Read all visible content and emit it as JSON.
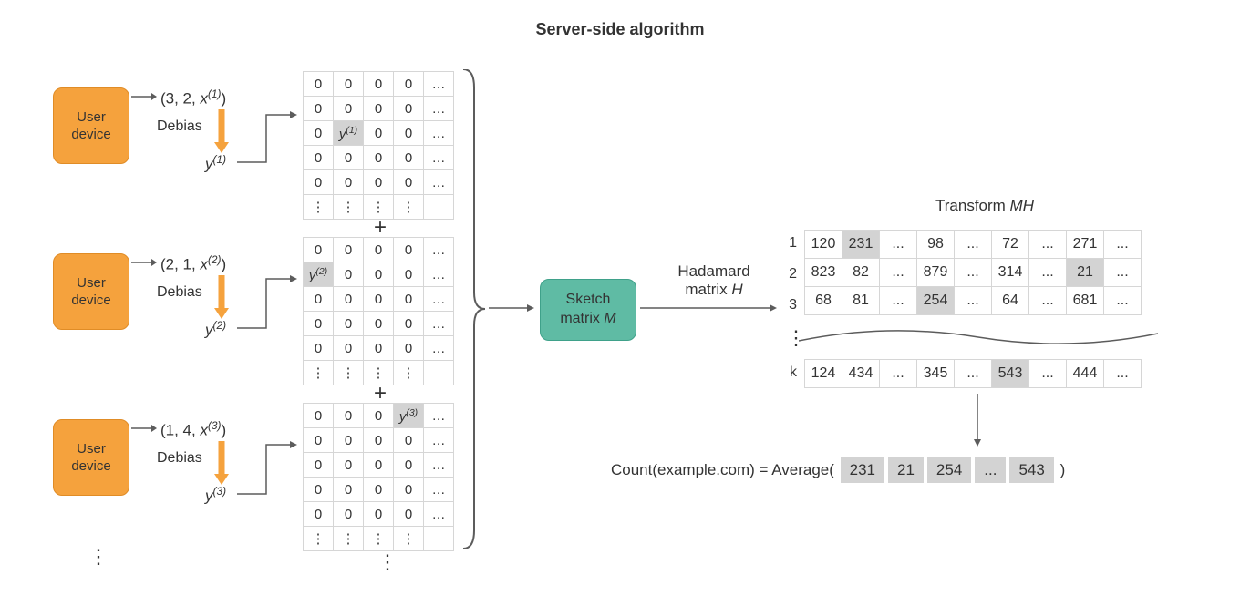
{
  "title": "Server-side algorithm",
  "devices": [
    {
      "label": "User\ndevice",
      "tuple_prefix": "(3, 2, ",
      "tuple_var": "x",
      "tuple_sup": "(1)",
      "tuple_suffix": ")",
      "debias": "Debias",
      "y_var": "y",
      "y_sup": "(1)"
    },
    {
      "label": "User\ndevice",
      "tuple_prefix": "(2, 1, ",
      "tuple_var": "x",
      "tuple_sup": "(2)",
      "tuple_suffix": ")",
      "debias": "Debias",
      "y_var": "y",
      "y_sup": "(2)"
    },
    {
      "label": "User\ndevice",
      "tuple_prefix": "(1, 4, ",
      "tuple_var": "x",
      "tuple_sup": "(3)",
      "tuple_suffix": ")",
      "debias": "Debias",
      "y_var": "y",
      "y_sup": "(3)"
    }
  ],
  "matrices": [
    {
      "hl_row": 2,
      "hl_col": 1,
      "hl_var": "y",
      "hl_sup": "(1)"
    },
    {
      "hl_row": 1,
      "hl_col": 0,
      "hl_var": "y",
      "hl_sup": "(2)"
    },
    {
      "hl_row": 0,
      "hl_col": 3,
      "hl_var": "y",
      "hl_sup": "(3)"
    }
  ],
  "plus_symbol": "+",
  "sketch_label": "Sketch\nmatrix ",
  "sketch_var": "M",
  "hadamard_label": "Hadamard\nmatrix ",
  "hadamard_var": "H",
  "transform_label": "Transform ",
  "transform_var": "MH",
  "mh": {
    "row_labels": [
      "1",
      "2",
      "3",
      "k"
    ],
    "rows": [
      [
        "120",
        "231",
        "...",
        "98",
        "...",
        "72",
        "...",
        "271",
        "..."
      ],
      [
        "823",
        "82",
        "...",
        "879",
        "...",
        "314",
        "...",
        "21",
        "..."
      ],
      [
        "68",
        "81",
        "...",
        "254",
        "...",
        "64",
        "...",
        "681",
        "..."
      ],
      [
        "124",
        "434",
        "...",
        "345",
        "...",
        "543",
        "...",
        "444",
        "..."
      ]
    ],
    "hl": [
      [
        0,
        1
      ],
      [
        1,
        7
      ],
      [
        2,
        3
      ],
      [
        3,
        5
      ]
    ]
  },
  "count_prefix": "Count(example.com) = Average( ",
  "count_vals": [
    "231",
    "21",
    "254",
    "...",
    "543"
  ],
  "count_suffix": " )",
  "ellipsis_glyph": "⋮",
  "vdots_glyph": "⋮"
}
